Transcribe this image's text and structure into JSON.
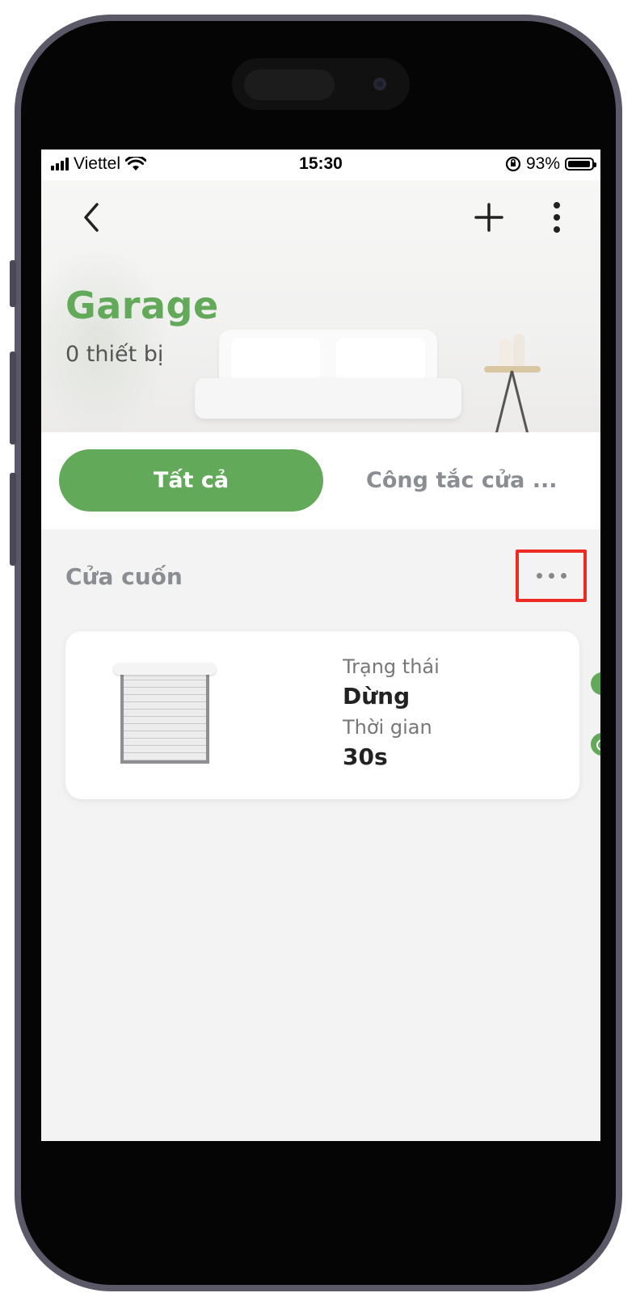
{
  "status_bar": {
    "carrier": "Viettel",
    "time": "15:30",
    "battery": "93%"
  },
  "header": {
    "title": "Garage",
    "subtitle": "0 thiết bị"
  },
  "tabs": [
    {
      "label": "Tất cả",
      "active": true
    },
    {
      "label": "Công tắc cửa ...",
      "active": false
    }
  ],
  "section": {
    "title": "Cửa cuốn"
  },
  "device": {
    "status_label": "Trạng thái",
    "status_value": "Dừng",
    "time_label": "Thời gian",
    "time_value": "30s"
  },
  "colors": {
    "accent": "#63a95a",
    "highlight": "#ee2a24"
  }
}
